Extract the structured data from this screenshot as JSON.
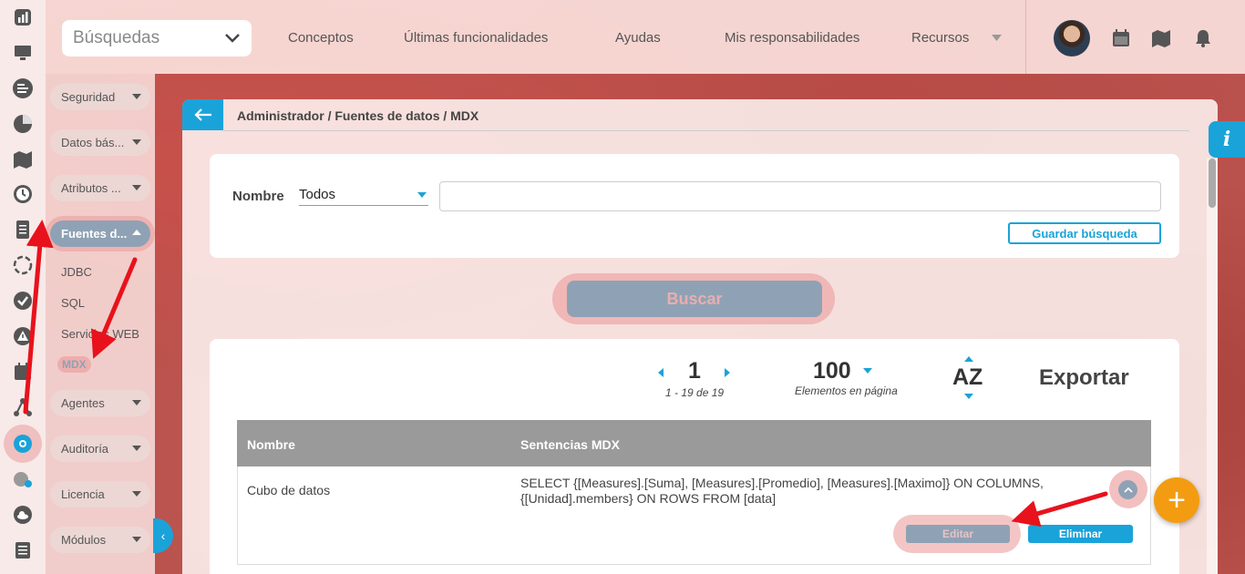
{
  "topbar": {
    "search_label": "Búsquedas",
    "nav": [
      "Conceptos",
      "Últimas funcionalidades",
      "Ayudas",
      "Mis responsabilidades",
      "Recursos"
    ]
  },
  "sidebar": {
    "rail_icons": [
      "bar-chart-icon",
      "monitor-icon",
      "align-icon",
      "pie-chart-icon",
      "map-icon",
      "clock-icon",
      "document-icon",
      "refresh-icon",
      "check-circle-icon",
      "warning-icon",
      "calendar-icon",
      "network-icon",
      "settings-icon",
      "users-icon",
      "cloud-icon",
      "list-icon"
    ],
    "groups": [
      {
        "label": "Seguridad"
      },
      {
        "label": "Datos bás..."
      },
      {
        "label": "Atributos ..."
      },
      {
        "label": "Fuentes d..."
      },
      {
        "label": "Agentes"
      },
      {
        "label": "Auditoría"
      },
      {
        "label": "Licencia"
      },
      {
        "label": "Módulos"
      }
    ],
    "subitems": [
      "JDBC",
      "SQL",
      "Servicios WEB",
      "MDX"
    ]
  },
  "breadcrumb": "Administrador / Fuentes de datos / MDX",
  "filter": {
    "label": "Nombre",
    "select_value": "Todos",
    "input_value": "",
    "save_button": "Guardar búsqueda"
  },
  "search_button": "Buscar",
  "pager": {
    "page": "1",
    "range": "1 - 19 de 19",
    "per_page": "100",
    "per_page_label": "Elementos en página",
    "sort": "AZ",
    "export": "Exportar"
  },
  "table": {
    "columns": [
      "Nombre",
      "Sentencias MDX"
    ],
    "rows": [
      {
        "name": "Cubo de datos",
        "mdx": "SELECT {[Measures].[Suma], [Measures].[Promedio], [Measures].[Maximo]} ON COLUMNS, {[Unidad].members} ON ROWS FROM [data]",
        "edit": "Editar",
        "delete": "Eliminar"
      }
    ]
  },
  "info_tab": "i",
  "fab": "+",
  "colors": {
    "accent": "#1aa3d9",
    "highlight": "#e89696",
    "fab": "#f39c12",
    "muted_button": "#8fa2b5",
    "annotation_arrow": "#e8121c"
  }
}
